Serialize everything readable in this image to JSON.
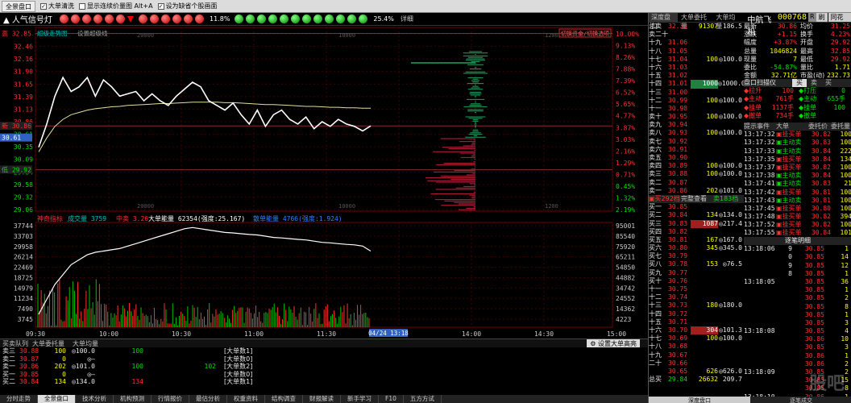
{
  "toolbar": {
    "button": "全景盘口",
    "check1": "大单清洗",
    "check2": "显示连续价量图",
    "check2_suffix": "Alt+A",
    "check3": "设为缺省个股画面",
    "right_items": [
      "中航飞机",
      "刷",
      "同花顺",
      "阿"
    ]
  },
  "signal": {
    "title": "人气信号灯",
    "pct1": "11.8%",
    "pct2": "25.4%",
    "detail": "详细"
  },
  "chart_top": {
    "line_label": "超级走势图",
    "line_label2": "设置超级线",
    "toggle_label": "切换资金/切换选项",
    "stock_label": "中航飞机 000768"
  },
  "chart_data": [
    {
      "type": "line",
      "title": "",
      "price_ticks": [
        "32.84",
        "32.46",
        "32.16",
        "31.90",
        "31.65",
        "31.39",
        "31.13",
        "30.86",
        "30.61",
        "30.35",
        "30.09",
        "29.84",
        "29.58",
        "29.32",
        "29.06"
      ],
      "pct_ticks": [
        "10.00%",
        "9.13%",
        "8.26%",
        "7.88%",
        "7.39%",
        "6.52%",
        "5.65%",
        "4.77%",
        "3.87%",
        "3.03%",
        "2.16%",
        "1.29%",
        "0.71%",
        "0.45%",
        "1.32%",
        "2.19%"
      ],
      "marker_high": "高 32.85",
      "marker_new": "新 30.86",
      "marker_low": "低 29.92",
      "marker_cur": "30.61",
      "vol_axis_top": [
        "20000",
        "10000",
        "1200"
      ],
      "price_series": [
        30.4,
        30.9,
        31.5,
        31.9,
        31.6,
        31.7,
        31.9,
        31.5,
        31.85,
        31.7,
        31.5,
        31.55,
        31.6,
        31.4,
        31.55,
        31.4,
        31.3,
        31.5,
        31.65,
        31.8,
        31.7,
        31.4,
        31.3,
        31.2,
        31.35,
        31.1,
        30.9,
        31.2,
        30.85,
        31.1,
        31.2,
        31.0,
        30.9,
        31.05,
        30.8,
        30.95,
        30.85,
        31.0,
        30.9,
        30.85,
        30.75,
        30.86
      ],
      "avg_series": [
        30.3,
        30.6,
        30.85,
        31.0,
        31.1,
        31.15,
        31.2,
        31.23,
        31.25,
        31.27,
        31.28,
        31.3,
        31.31,
        31.32,
        31.33,
        31.34,
        31.34,
        31.35,
        31.36,
        31.37,
        31.37,
        31.37,
        31.37,
        31.36,
        31.36,
        31.35,
        31.34,
        31.33,
        31.32,
        31.32,
        31.31,
        31.3,
        31.29,
        31.28,
        31.28,
        31.27,
        31.26,
        31.26,
        31.25,
        31.25,
        31.24,
        31.24
      ]
    },
    {
      "type": "area",
      "title": "",
      "indicator_label": "神奇指标",
      "ind1": "成交量 3759",
      "ind2": "中卖 3.26",
      "ind3": "大单能量 62354(强度:25.167)",
      "ind4": "散单能量 4766(强度:1.924)",
      "left_ticks": [
        "37744",
        "33703",
        "29958",
        "26214",
        "22469",
        "18725",
        "14979",
        "11234",
        "7490",
        "3745"
      ],
      "right_ticks": [
        "95001",
        "85540",
        "75920",
        "65211",
        "54850",
        "44882",
        "34742",
        "24552",
        "14362",
        "4223"
      ],
      "energy_series": [
        2000,
        8000,
        14000,
        18000,
        22000,
        24000,
        26000,
        27000,
        27500,
        28000,
        28500,
        29500,
        30500,
        31500,
        32500,
        33500,
        34500,
        35500,
        36500,
        37000,
        36500,
        36000,
        35500,
        35000,
        34800,
        34500,
        34200,
        34000,
        33500,
        33000,
        32800,
        32500,
        32200,
        32000,
        31500,
        31000,
        30800,
        30500,
        30200,
        30000,
        29500,
        27500
      ]
    }
  ],
  "time_axis": [
    "09:30",
    "10:00",
    "10:30",
    "11:00",
    "11:30",
    "04/24 13:18",
    "14:00",
    "14:30",
    "15:00"
  ],
  "quote": {
    "tabs": [
      "深度盘口",
      "大单委托量",
      "大单均量"
    ],
    "name": "中航飞机",
    "code": "000768",
    "r": "R",
    "total_sell_label": "总卖",
    "total_sell_price": "32.33",
    "total_sell_vol": "91307",
    "total_sell_avg": "186.5",
    "asks": [
      {
        "lvl": "卖二十",
        "price": "",
        "vol": "",
        "big": ""
      },
      {
        "lvl": "十九",
        "price": "31.06",
        "vol": "",
        "big": ""
      },
      {
        "lvl": "十八",
        "price": "31.05",
        "vol": "",
        "big": ""
      },
      {
        "lvl": "十七",
        "price": "31.04",
        "vol": "100",
        "big": "100.0"
      },
      {
        "lvl": "十六",
        "price": "31.03",
        "vol": "",
        "big": ""
      },
      {
        "lvl": "十五",
        "price": "31.02",
        "vol": "",
        "big": ""
      },
      {
        "lvl": "十四",
        "price": "31.01",
        "vol": "1000",
        "big": "1000.0"
      },
      {
        "lvl": "十三",
        "price": "31.00",
        "vol": "",
        "big": ""
      },
      {
        "lvl": "十二",
        "price": "30.99",
        "vol": "100",
        "big": "100.0"
      },
      {
        "lvl": "十一",
        "price": "30.98",
        "vol": "",
        "big": ""
      },
      {
        "lvl": "卖十",
        "price": "30.95",
        "vol": "100",
        "big": "100.0"
      },
      {
        "lvl": "卖九",
        "price": "30.94",
        "vol": "",
        "big": ""
      },
      {
        "lvl": "卖八",
        "price": "30.93",
        "vol": "100",
        "big": "100.0"
      },
      {
        "lvl": "卖七",
        "price": "30.92",
        "vol": "",
        "big": ""
      },
      {
        "lvl": "卖六",
        "price": "30.91",
        "vol": "",
        "big": ""
      },
      {
        "lvl": "卖五",
        "price": "30.90",
        "vol": "",
        "big": ""
      },
      {
        "lvl": "卖四",
        "price": "30.89",
        "vol": "100",
        "big": "100.0"
      },
      {
        "lvl": "卖三",
        "price": "30.88",
        "vol": "100",
        "big": "100.0"
      },
      {
        "lvl": "卖二",
        "price": "30.87",
        "vol": "",
        "big": ""
      },
      {
        "lvl": "卖一",
        "price": "30.86",
        "vol": "202",
        "big": "101.0"
      }
    ],
    "mid_tabs": [
      "买292档",
      "完整查看",
      "卖183档"
    ],
    "bids": [
      {
        "lvl": "买一",
        "price": "30.85",
        "vol": "",
        "big": ""
      },
      {
        "lvl": "买二",
        "price": "30.84",
        "vol": "134",
        "big": "134.0"
      },
      {
        "lvl": "买三",
        "price": "30.83",
        "vol": "1087",
        "big": "217.4"
      },
      {
        "lvl": "买四",
        "price": "30.82",
        "vol": "",
        "big": ""
      },
      {
        "lvl": "买五",
        "price": "30.81",
        "vol": "167",
        "big": "167.0"
      },
      {
        "lvl": "买六",
        "price": "30.80",
        "vol": "345",
        "big": "345.0"
      },
      {
        "lvl": "买七",
        "price": "30.79",
        "vol": "",
        "big": ""
      },
      {
        "lvl": "买八",
        "price": "30.78",
        "vol": "153",
        "big": "76.5"
      },
      {
        "lvl": "买九",
        "price": "30.77",
        "vol": "",
        "big": ""
      },
      {
        "lvl": "买十",
        "price": "30.76",
        "vol": "",
        "big": ""
      },
      {
        "lvl": "十一",
        "price": "30.75",
        "vol": "",
        "big": ""
      },
      {
        "lvl": "十二",
        "price": "30.74",
        "vol": "",
        "big": ""
      },
      {
        "lvl": "十三",
        "price": "30.73",
        "vol": "180",
        "big": "180.0"
      },
      {
        "lvl": "十四",
        "price": "30.72",
        "vol": "",
        "big": ""
      },
      {
        "lvl": "十五",
        "price": "30.71",
        "vol": "",
        "big": ""
      },
      {
        "lvl": "十六",
        "price": "30.70",
        "vol": "304",
        "big": "101.3"
      },
      {
        "lvl": "十七",
        "price": "30.69",
        "vol": "100",
        "big": "100.0"
      },
      {
        "lvl": "十八",
        "price": "30.68",
        "vol": "",
        "big": ""
      },
      {
        "lvl": "十九",
        "price": "30.67",
        "vol": "",
        "big": ""
      },
      {
        "lvl": "二十",
        "price": "30.66",
        "vol": "",
        "big": ""
      },
      {
        "lvl": "",
        "price": "30.65",
        "vol": "626",
        "big": "626.0"
      }
    ],
    "total_buy_label": "总买",
    "total_buy_price": "29.84",
    "total_buy_vol": "26632",
    "total_buy_avg": "209.7",
    "bottom_tabs": [
      "深度盘口",
      "逐笔成交"
    ]
  },
  "stats": [
    {
      "k": "最新",
      "v": "30.86",
      "k2": "均价",
      "v2": "31.25"
    },
    {
      "k": "涨跌",
      "v": "+1.15",
      "k2": "换手",
      "v2": "4.23%"
    },
    {
      "k": "幅度",
      "v": "+3.87%",
      "k2": "开盘",
      "v2": "29.92"
    },
    {
      "k": "总量",
      "v": "1046824",
      "k2": "最高",
      "v2": "32.85"
    },
    {
      "k": "现量",
      "v": "7",
      "k2": "最低",
      "v2": "29.92"
    },
    {
      "k": "委比",
      "v": "-54.87%",
      "k2": "量比",
      "v2": "1.71"
    },
    {
      "k": "金额",
      "v": "32.71亿",
      "k2": "市盈(动)",
      "v2": "232.73"
    },
    {
      "k": "涨停",
      "v": "32.68",
      "k2": "跌停",
      "v2": "26.74"
    }
  ],
  "scan": {
    "title": "盘口扫描仪",
    "tabs": [
      "买",
      "卖",
      "买"
    ],
    "rows": [
      {
        "a": "拉升",
        "b": "100",
        "c": "打压",
        "d": "0"
      },
      {
        "a": "主动",
        "b": "761手",
        "c": "主动",
        "d": "655手"
      },
      {
        "a": "挂单",
        "b": "1137手",
        "c": "挂单",
        "d": "100"
      },
      {
        "a": "撤单",
        "b": "734手",
        "c": "撤单",
        "d": ""
      }
    ]
  },
  "tips": {
    "headers": [
      "提示事件",
      "大单",
      "委托价",
      "委托量"
    ],
    "rows": [
      {
        "t": "13:17:32",
        "e": "挂买单",
        "p": "30.82",
        "q": "100"
      },
      {
        "t": "13:17:32",
        "e": "主动卖",
        "p": "30.83",
        "q": "100"
      },
      {
        "t": "13:17:33",
        "e": "主动卖",
        "p": "30.84",
        "q": "222"
      },
      {
        "t": "13:17:35",
        "e": "挂买单",
        "p": "30.84",
        "q": "134"
      },
      {
        "t": "13:17:37",
        "e": "挂买单",
        "p": "30.82",
        "q": "100"
      },
      {
        "t": "13:17:38",
        "e": "主动卖",
        "p": "30.84",
        "q": "100"
      },
      {
        "t": "13:17:41",
        "e": "主动卖",
        "p": "30.83",
        "q": "21"
      },
      {
        "t": "13:17:42",
        "e": "挂买单",
        "p": "30.81",
        "q": "100"
      },
      {
        "t": "13:17:43",
        "e": "主动卖",
        "p": "30.81",
        "q": "100"
      },
      {
        "t": "13:17:45",
        "e": "挂买单",
        "p": "30.80",
        "q": "100"
      },
      {
        "t": "13:17:48",
        "e": "挂买单",
        "p": "30.82",
        "q": "394"
      },
      {
        "t": "13:17:52",
        "e": "挂买单",
        "p": "30.82",
        "q": "100"
      },
      {
        "t": "13:17:55",
        "e": "挂买单",
        "p": "30.84",
        "q": "101"
      },
      {
        "t": "13:17:57",
        "e": "挂买单",
        "p": "30.85",
        "q": "100"
      }
    ]
  },
  "trades": {
    "title": "逐笔明细",
    "rows": [
      {
        "t": "13:18:06",
        "n": "9",
        "p": "30.85",
        "v": "1"
      },
      {
        "t": "",
        "n": "0",
        "p": "30.85",
        "v": "14"
      },
      {
        "t": "",
        "n": "9",
        "p": "30.85",
        "v": "12"
      },
      {
        "t": "",
        "n": "8",
        "p": "30.85",
        "v": "1"
      },
      {
        "t": "13:18:05",
        "n": "",
        "p": "30.85",
        "v": "36"
      },
      {
        "t": "",
        "n": "",
        "p": "30.85",
        "v": "1"
      },
      {
        "t": "",
        "n": "",
        "p": "30.85",
        "v": "2"
      },
      {
        "t": "",
        "n": "",
        "p": "30.85",
        "v": "8"
      },
      {
        "t": "",
        "n": "",
        "p": "30.85",
        "v": "1"
      },
      {
        "t": "",
        "n": "",
        "p": "30.85",
        "v": "3"
      },
      {
        "t": "13:18:08",
        "n": "",
        "p": "30.85",
        "v": "4"
      },
      {
        "t": "",
        "n": "",
        "p": "30.86",
        "v": "10"
      },
      {
        "t": "",
        "n": "",
        "p": "30.85",
        "v": "3"
      },
      {
        "t": "",
        "n": "",
        "p": "30.86",
        "v": "1"
      },
      {
        "t": "",
        "n": "",
        "p": "30.86",
        "v": "2"
      },
      {
        "t": "13:18:09",
        "n": "",
        "p": "30.85",
        "v": "2"
      },
      {
        "t": "",
        "n": "",
        "p": "30.85",
        "v": "15"
      },
      {
        "t": "",
        "n": "",
        "p": "30.85",
        "v": "8"
      },
      {
        "t": "13:18:10",
        "n": "",
        "p": "30.86",
        "v": "1"
      },
      {
        "t": "",
        "n": "",
        "p": "30.85",
        "v": "2"
      }
    ]
  },
  "bottom": {
    "hdr": [
      "买卖队列",
      "大单委托量",
      "大单均量"
    ],
    "button": "设置大单高亮",
    "rows": [
      {
        "lvl": "卖三",
        "price": "30.88",
        "vol": "100",
        "avg": "100.0",
        "c1": "100",
        "c2": "",
        "tag": "[大单数1]"
      },
      {
        "lvl": "卖二",
        "price": "30.87",
        "vol": "0",
        "avg": "—",
        "c1": "",
        "c2": "",
        "tag": "[大单数0]"
      },
      {
        "lvl": "卖一",
        "price": "30.86",
        "vol": "202",
        "avg": "101.0",
        "c1": "100",
        "c2": "102",
        "tag": "[大单数2]"
      },
      {
        "lvl": "买一",
        "price": "30.85",
        "vol": "0",
        "avg": "—",
        "c1": "",
        "c2": "",
        "tag": "[大单数0]"
      },
      {
        "lvl": "买二",
        "price": "30.84",
        "vol": "134",
        "avg": "134.0",
        "c1": "134",
        "c2": "",
        "tag": "[大单数1]"
      }
    ],
    "tabs": [
      "分时走势",
      "全景盘口",
      "技术分析",
      "机构预测",
      "行情报价",
      "最估分析",
      "权重资料",
      "结构调查",
      "财报解读",
      "新手学习",
      "F10",
      "五方方试"
    ]
  },
  "watermark": "股吧",
  "colors": {
    "up": "#ff3030",
    "down": "#00e000",
    "price_line": "#ffffff",
    "avg_line": "#e0e0a0",
    "grid": "#601010"
  }
}
